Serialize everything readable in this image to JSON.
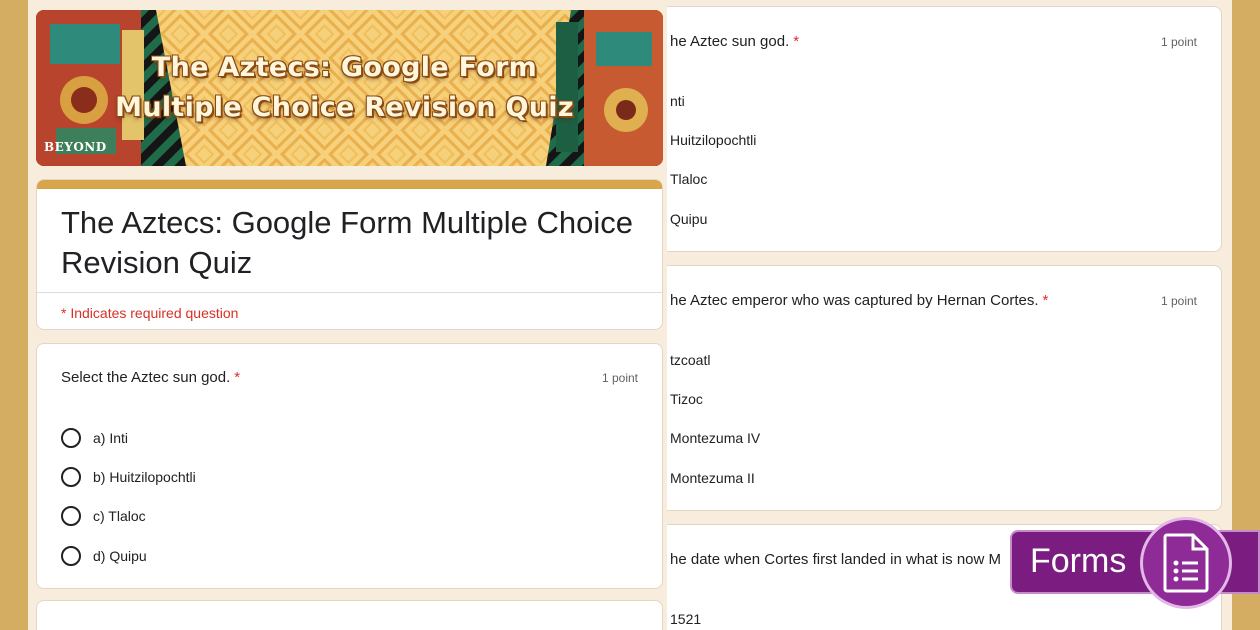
{
  "banner": {
    "title_line1": "The Aztecs: Google Form",
    "title_line2": "Multiple Choice Revision Quiz",
    "logo": "BEYOND"
  },
  "form": {
    "title": "The Aztecs: Google Form Multiple Choice Revision Quiz",
    "required_note": "* Indicates required question"
  },
  "left_question": {
    "text": "Select the Aztec sun god.",
    "required_mark": "*",
    "points": "1 point",
    "options": [
      "a) Inti",
      "b) Huitzilopochtli",
      "c) Tlaloc",
      "d) Quipu"
    ]
  },
  "right_questions": [
    {
      "text": "he Aztec sun god.",
      "required_mark": "*",
      "points": "1 point",
      "options": [
        "nti",
        "Huitzilopochtli",
        "Tlaloc",
        "Quipu"
      ]
    },
    {
      "text": "he Aztec emperor who was captured by Hernan Cortes.",
      "required_mark": "*",
      "points": "1 point",
      "options": [
        "tzcoatl",
        "Tizoc",
        "Montezuma IV",
        "Montezuma II"
      ]
    },
    {
      "text": "he date when Cortes first landed in what is now M",
      "options": [
        "1521"
      ]
    }
  ],
  "badge": {
    "label": "Forms",
    "icon": "google-forms-icon"
  },
  "colors": {
    "accent": "#d9a54a",
    "required": "#d93025",
    "badge": "#7b1d80"
  }
}
